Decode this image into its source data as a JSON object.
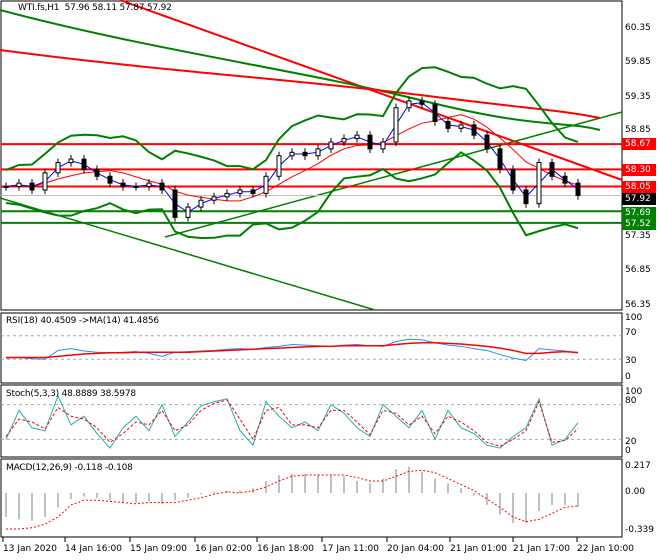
{
  "header": {
    "symbol_label": "WTI.fs,H1",
    "ohlc": "57.96 58.11 57.87 57.92"
  },
  "price_axis": [
    "60.35",
    "59.85",
    "59.35",
    "58.85",
    "57.35",
    "56.85",
    "56.35"
  ],
  "price_tags": [
    {
      "value": "58.67",
      "color": "#ff0000"
    },
    {
      "value": "58.30",
      "color": "#ff0000"
    },
    {
      "value": "58.05",
      "color": "#ff0000"
    },
    {
      "value": "57.92",
      "color": "#000000"
    },
    {
      "value": "57.69",
      "color": "#008000"
    },
    {
      "value": "57.52",
      "color": "#008000"
    }
  ],
  "time_axis": [
    "13 Jan 2020",
    "14 Jan 16:00",
    "15 Jan 09:00",
    "16 Jan 02:00",
    "16 Jan 18:00",
    "17 Jan 11:00",
    "20 Jan 04:00",
    "21 Jan 01:00",
    "21 Jan 17:00",
    "22 Jan 10:00"
  ],
  "rsi": {
    "label": "RSI(18) 40.4509  ->MA(14) 41.4856",
    "axis": [
      "100",
      "70",
      "30",
      "0"
    ]
  },
  "stoch": {
    "label": "Stoch(5,3,3) 48.8889 38.5978",
    "axis": [
      "100",
      "80",
      "20",
      "0"
    ]
  },
  "macd": {
    "label": "MACD(12,26,9) -0.118 -0.108",
    "axis": [
      "0.217",
      "0.00",
      "-0.339"
    ]
  },
  "chart_data": {
    "type": "line",
    "price_range": [
      56.1,
      60.6
    ],
    "close": [
      58.05,
      58.1,
      58.0,
      58.25,
      58.4,
      58.45,
      58.3,
      58.2,
      58.1,
      58.05,
      58.05,
      58.1,
      58.0,
      57.6,
      57.75,
      57.85,
      57.9,
      57.95,
      58.0,
      57.95,
      58.2,
      58.5,
      58.55,
      58.5,
      58.6,
      58.7,
      58.75,
      58.8,
      58.6,
      58.7,
      59.2,
      59.3,
      59.25,
      59.0,
      58.9,
      58.95,
      58.8,
      58.6,
      58.3,
      58.0,
      57.8,
      58.4,
      58.2,
      58.1,
      57.92
    ],
    "levels": {
      "resistance": [
        58.67,
        58.3,
        58.05
      ],
      "support": [
        57.69,
        57.52
      ]
    },
    "rsi": [
      32,
      33,
      31,
      30,
      45,
      48,
      44,
      42,
      41,
      42,
      43,
      40,
      35,
      42,
      43,
      44,
      45,
      47,
      48,
      47,
      50,
      52,
      55,
      54,
      53,
      52,
      54,
      55,
      53,
      52,
      60,
      64,
      63,
      58,
      54,
      52,
      48,
      45,
      38,
      32,
      28,
      48,
      46,
      44,
      40.45
    ],
    "rsi_ma": [
      33,
      33,
      33,
      33,
      35,
      37,
      39,
      40,
      41,
      41,
      42,
      42,
      42,
      42,
      42,
      43,
      44,
      45,
      46,
      47,
      48,
      49,
      50,
      51,
      52,
      52,
      53,
      53,
      53,
      53,
      55,
      57,
      58,
      58,
      57,
      56,
      54,
      52,
      49,
      45,
      40,
      40,
      42,
      43,
      41.49
    ],
    "stoch_k": [
      20,
      70,
      40,
      35,
      95,
      45,
      60,
      30,
      5,
      40,
      60,
      35,
      80,
      25,
      50,
      78,
      85,
      90,
      35,
      10,
      85,
      60,
      40,
      50,
      35,
      80,
      65,
      40,
      25,
      80,
      60,
      40,
      70,
      20,
      70,
      40,
      30,
      10,
      5,
      25,
      40,
      90,
      10,
      20,
      48.89
    ],
    "stoch_d": [
      25,
      55,
      50,
      38,
      75,
      60,
      55,
      40,
      15,
      30,
      50,
      45,
      70,
      35,
      45,
      70,
      82,
      88,
      55,
      20,
      70,
      75,
      45,
      45,
      40,
      70,
      70,
      50,
      28,
      70,
      65,
      45,
      60,
      30,
      60,
      50,
      35,
      15,
      8,
      20,
      35,
      85,
      15,
      18,
      38.6
    ],
    "macd_hist": [
      -0.2,
      -0.22,
      -0.23,
      -0.2,
      -0.12,
      -0.05,
      -0.03,
      -0.04,
      -0.06,
      -0.08,
      -0.08,
      -0.07,
      -0.09,
      -0.06,
      -0.04,
      -0.01,
      0.01,
      0.02,
      0.02,
      0.04,
      0.1,
      0.15,
      0.16,
      0.16,
      0.15,
      0.15,
      0.14,
      0.1,
      0.08,
      0.12,
      0.2,
      0.22,
      0.18,
      0.12,
      0.08,
      0.04,
      -0.02,
      -0.1,
      -0.18,
      -0.25,
      -0.25,
      -0.15,
      -0.1,
      -0.1,
      -0.118
    ],
    "macd_signal": [
      -0.3,
      -0.3,
      -0.29,
      -0.26,
      -0.2,
      -0.1,
      -0.06,
      -0.06,
      -0.07,
      -0.08,
      -0.09,
      -0.08,
      -0.08,
      -0.08,
      -0.06,
      -0.04,
      -0.01,
      0.01,
      0.0,
      0.02,
      0.05,
      0.1,
      0.14,
      0.15,
      0.15,
      0.15,
      0.15,
      0.13,
      0.1,
      0.1,
      0.14,
      0.18,
      0.19,
      0.17,
      0.12,
      0.07,
      0.02,
      -0.05,
      -0.12,
      -0.2,
      -0.24,
      -0.22,
      -0.17,
      -0.12,
      -0.108
    ],
    "colors": {
      "resistance": "#ff0000",
      "support": "#008000",
      "rsi": "#1e90ff",
      "stoch_k": "#20b2aa"
    }
  }
}
